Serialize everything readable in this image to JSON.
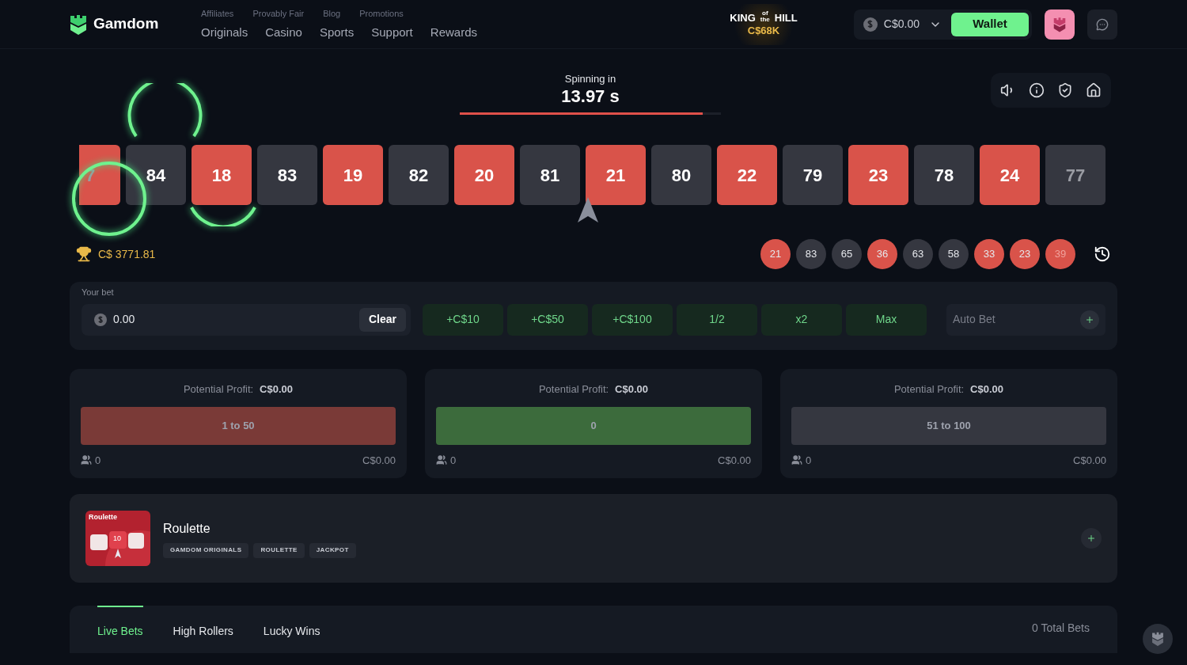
{
  "header": {
    "logo": "Gamdom",
    "sub_links": [
      "Affiliates",
      "Provably Fair",
      "Blog",
      "Promotions"
    ],
    "nav": [
      "Originals",
      "Casino",
      "Sports",
      "Support",
      "Rewards"
    ],
    "promo": {
      "line1a": "KING",
      "line1b": "of the",
      "line1c": "HILL",
      "amount": "C$68K"
    },
    "balance": "C$0.00",
    "wallet": "Wallet"
  },
  "timer": {
    "label": "Spinning in",
    "value": "13.97 s",
    "level": 0.93
  },
  "strip": [
    {
      "n": "7",
      "color": "#d9534a",
      "faded": true
    },
    {
      "n": "84",
      "color": "#353740",
      "faded": false
    },
    {
      "n": "18",
      "color": "#d9534a",
      "faded": false
    },
    {
      "n": "83",
      "color": "#353740",
      "faded": false
    },
    {
      "n": "19",
      "color": "#d9534a",
      "faded": false
    },
    {
      "n": "82",
      "color": "#353740",
      "faded": false
    },
    {
      "n": "20",
      "color": "#d9534a",
      "faded": false
    },
    {
      "n": "81",
      "color": "#353740",
      "faded": false
    },
    {
      "n": "21",
      "color": "#d9534a",
      "faded": false
    },
    {
      "n": "80",
      "color": "#353740",
      "faded": false
    },
    {
      "n": "22",
      "color": "#d9534a",
      "faded": false
    },
    {
      "n": "79",
      "color": "#353740",
      "faded": false
    },
    {
      "n": "23",
      "color": "#d9534a",
      "faded": false
    },
    {
      "n": "78",
      "color": "#353740",
      "faded": false
    },
    {
      "n": "24",
      "color": "#d9534a",
      "faded": false
    },
    {
      "n": "77",
      "color": "#353740",
      "faded": true
    }
  ],
  "jackpot": "C$ 3771.81",
  "history": [
    {
      "n": "21",
      "color": "#d9534a",
      "faded": false
    },
    {
      "n": "83",
      "color": "#353740",
      "faded": false
    },
    {
      "n": "65",
      "color": "#353740",
      "faded": false
    },
    {
      "n": "36",
      "color": "#d9534a",
      "faded": false
    },
    {
      "n": "63",
      "color": "#353740",
      "faded": false
    },
    {
      "n": "58",
      "color": "#353740",
      "faded": false
    },
    {
      "n": "33",
      "color": "#d9534a",
      "faded": false
    },
    {
      "n": "23",
      "color": "#d9534a",
      "faded": false
    },
    {
      "n": "39",
      "color": "#d9534a",
      "faded": true
    }
  ],
  "bet": {
    "label": "Your bet",
    "value": "0.00",
    "clear": "Clear",
    "quick": [
      "+C$10",
      "+C$50",
      "+C$100",
      "1/2",
      "x2",
      "Max"
    ],
    "auto_bet": "Auto Bet"
  },
  "options": [
    {
      "profit_label": "Potential Profit:",
      "profit": "C$0.00",
      "button": "1 to 50",
      "color": "#7a3a37",
      "players": "0",
      "total": "C$0.00"
    },
    {
      "profit_label": "Potential Profit:",
      "profit": "C$0.00",
      "button": "0",
      "color": "#3c6b3c",
      "players": "0",
      "total": "C$0.00"
    },
    {
      "profit_label": "Potential Profit:",
      "profit": "C$0.00",
      "button": "51 to 100",
      "color": "#353740",
      "players": "0",
      "total": "C$0.00"
    }
  ],
  "game": {
    "thumb_label": "Roulette",
    "thumb_number": "10",
    "title": "Roulette",
    "tags": [
      "GAMDOM ORIGINALS",
      "ROULETTE",
      "JACKPOT"
    ]
  },
  "bets_tabs": [
    {
      "label": "Live Bets",
      "selected": true
    },
    {
      "label": "High Rollers",
      "selected": false
    },
    {
      "label": "Lucky Wins",
      "selected": false
    }
  ],
  "total_bets": "0 Total Bets"
}
